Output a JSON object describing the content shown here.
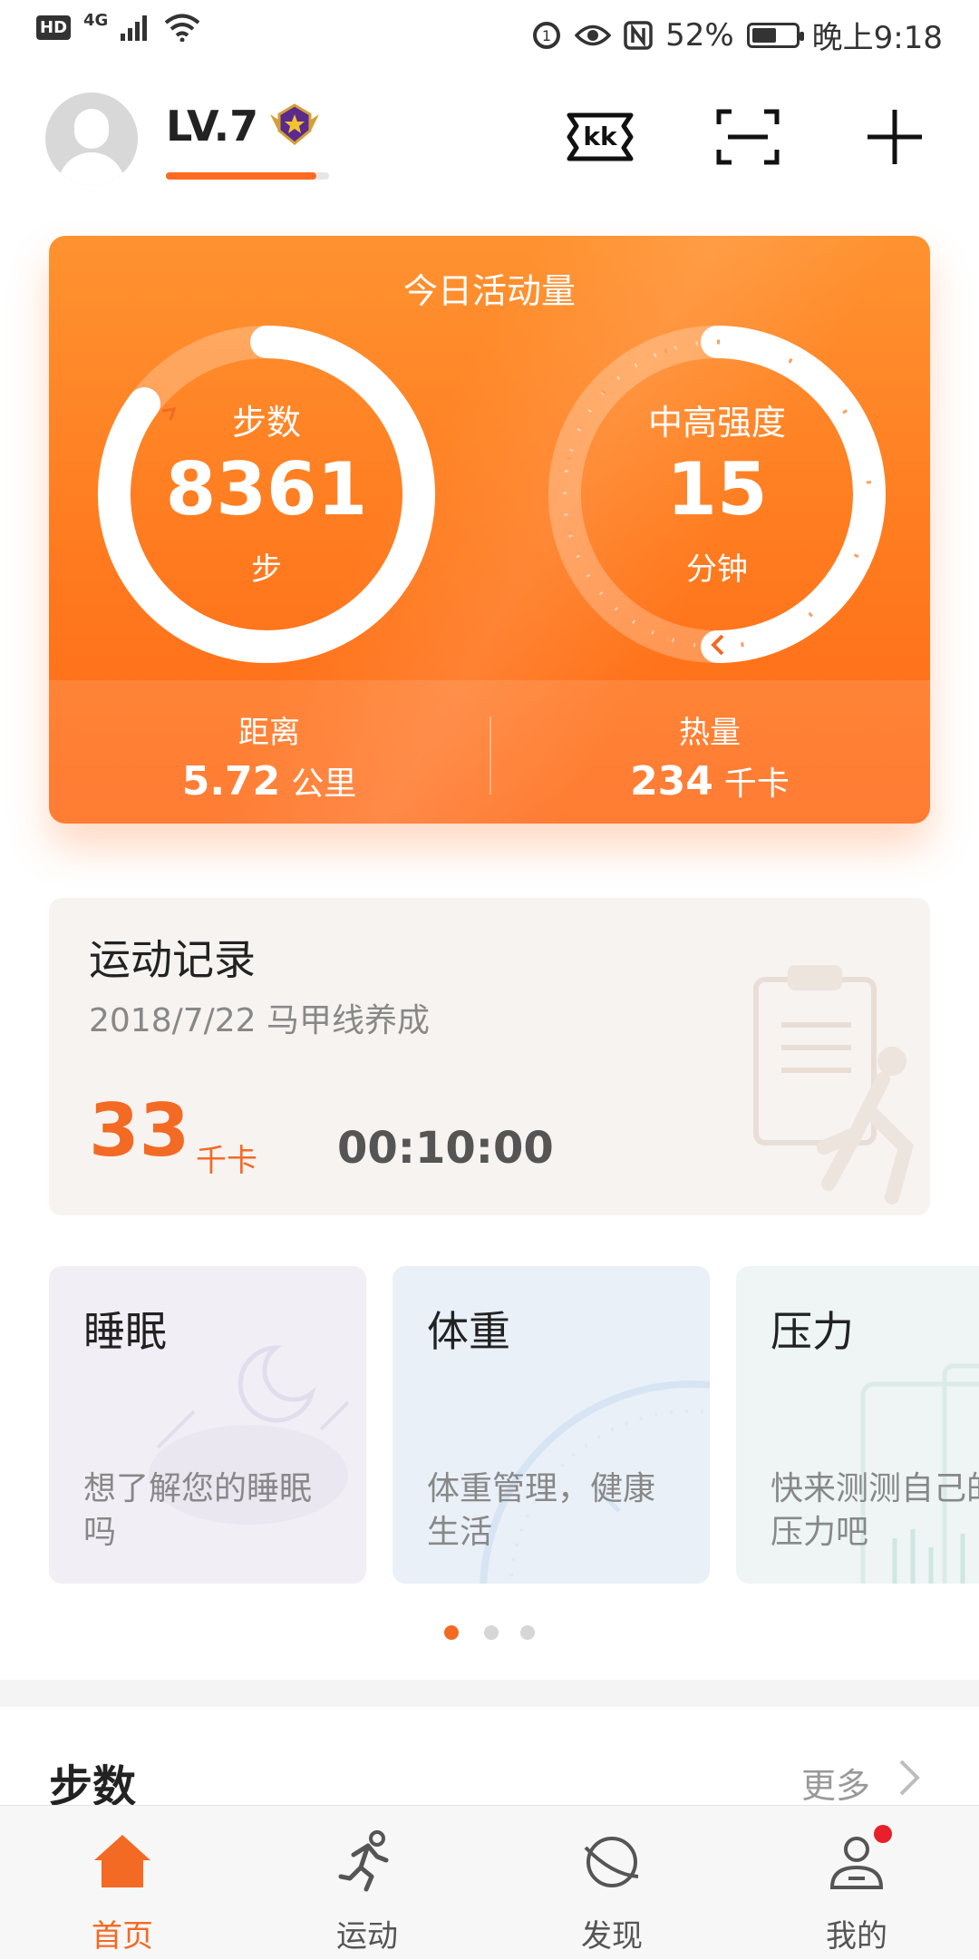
{
  "status_bar": {
    "network": "4G",
    "battery": "52%",
    "time": "晚上9:18"
  },
  "header": {
    "level": "LV.7",
    "level_progress": 0.92
  },
  "activity": {
    "title": "今日活动量",
    "steps_label": "步数",
    "steps_value": "8361",
    "steps_unit": "步",
    "intensity_label": "中高强度",
    "intensity_value": "15",
    "intensity_unit": "分钟",
    "distance_label": "距离",
    "distance_value": "5.72",
    "distance_unit": "公里",
    "calories_label": "热量",
    "calories_value": "234",
    "calories_unit": "千卡"
  },
  "record": {
    "title": "运动记录",
    "subtitle": "2018/7/22  马甲线养成",
    "kcal": "33",
    "kcal_unit": "千卡",
    "duration": "00:10:00"
  },
  "cards": [
    {
      "title": "睡眠",
      "desc": "想了解您的睡眠吗"
    },
    {
      "title": "体重",
      "desc": "体重管理，健康生活"
    },
    {
      "title": "压力",
      "desc": "快来测测自己的压力吧"
    }
  ],
  "pager": {
    "active": 0,
    "count": 3
  },
  "steps_section": {
    "title": "步数",
    "more": "更多"
  },
  "nav": [
    {
      "label": "首页",
      "icon": "home-icon",
      "active": true
    },
    {
      "label": "运动",
      "icon": "running-icon",
      "active": false
    },
    {
      "label": "发现",
      "icon": "discover-icon",
      "active": false
    },
    {
      "label": "我的",
      "icon": "profile-icon",
      "active": false
    }
  ],
  "colors": {
    "accent": "#f36a24",
    "card_orange": "#ff7a1e",
    "badge_red": "#e8202a"
  }
}
